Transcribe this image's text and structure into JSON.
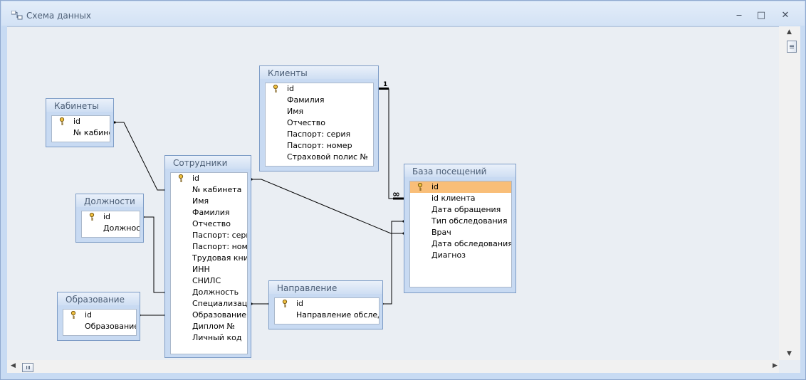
{
  "window": {
    "title": "Схема данных",
    "icon": "relationships-icon",
    "controls": [
      "minimize",
      "maximize",
      "close"
    ]
  },
  "tables": {
    "klienty": {
      "name": "Клиенты",
      "fields": [
        "id",
        "Фамилия",
        "Имя",
        "Отчество",
        "Паспорт: серия",
        "Паспорт: номер",
        "Страховой полис №"
      ]
    },
    "kabinety": {
      "name": "Кабинеты",
      "fields": [
        "id",
        "№ кабинета"
      ]
    },
    "sotrudniki": {
      "name": "Сотрудники",
      "fields": [
        "id",
        "№ кабинета",
        "Имя",
        "Фамилия",
        "Отчество",
        "Паспорт: серия",
        "Паспорт: номер",
        "Трудовая книжка",
        "ИНН",
        "СНИЛС",
        "Должность",
        "Специализация",
        "Образование",
        "Диплом №",
        "Личный код"
      ]
    },
    "dolzhnosti": {
      "name": "Должности",
      "fields": [
        "id",
        "Должность"
      ]
    },
    "obrazovanie": {
      "name": "Образование",
      "fields": [
        "id",
        "Образование"
      ]
    },
    "napravlenie": {
      "name": "Направление",
      "fields": [
        "id",
        "Направление обследования"
      ]
    },
    "baza": {
      "name": "База посещений",
      "fields": [
        "id",
        "id клиента",
        "Дата обращения",
        "Тип обследования",
        "Врач",
        "Дата обследования",
        "Диагноз"
      ],
      "selected_field": "id"
    }
  },
  "relationship_labels": {
    "one": "1",
    "many": "∞"
  },
  "colors": {
    "selected": "#f9be78",
    "line": "#000000",
    "canvas": "#eaeef3"
  }
}
